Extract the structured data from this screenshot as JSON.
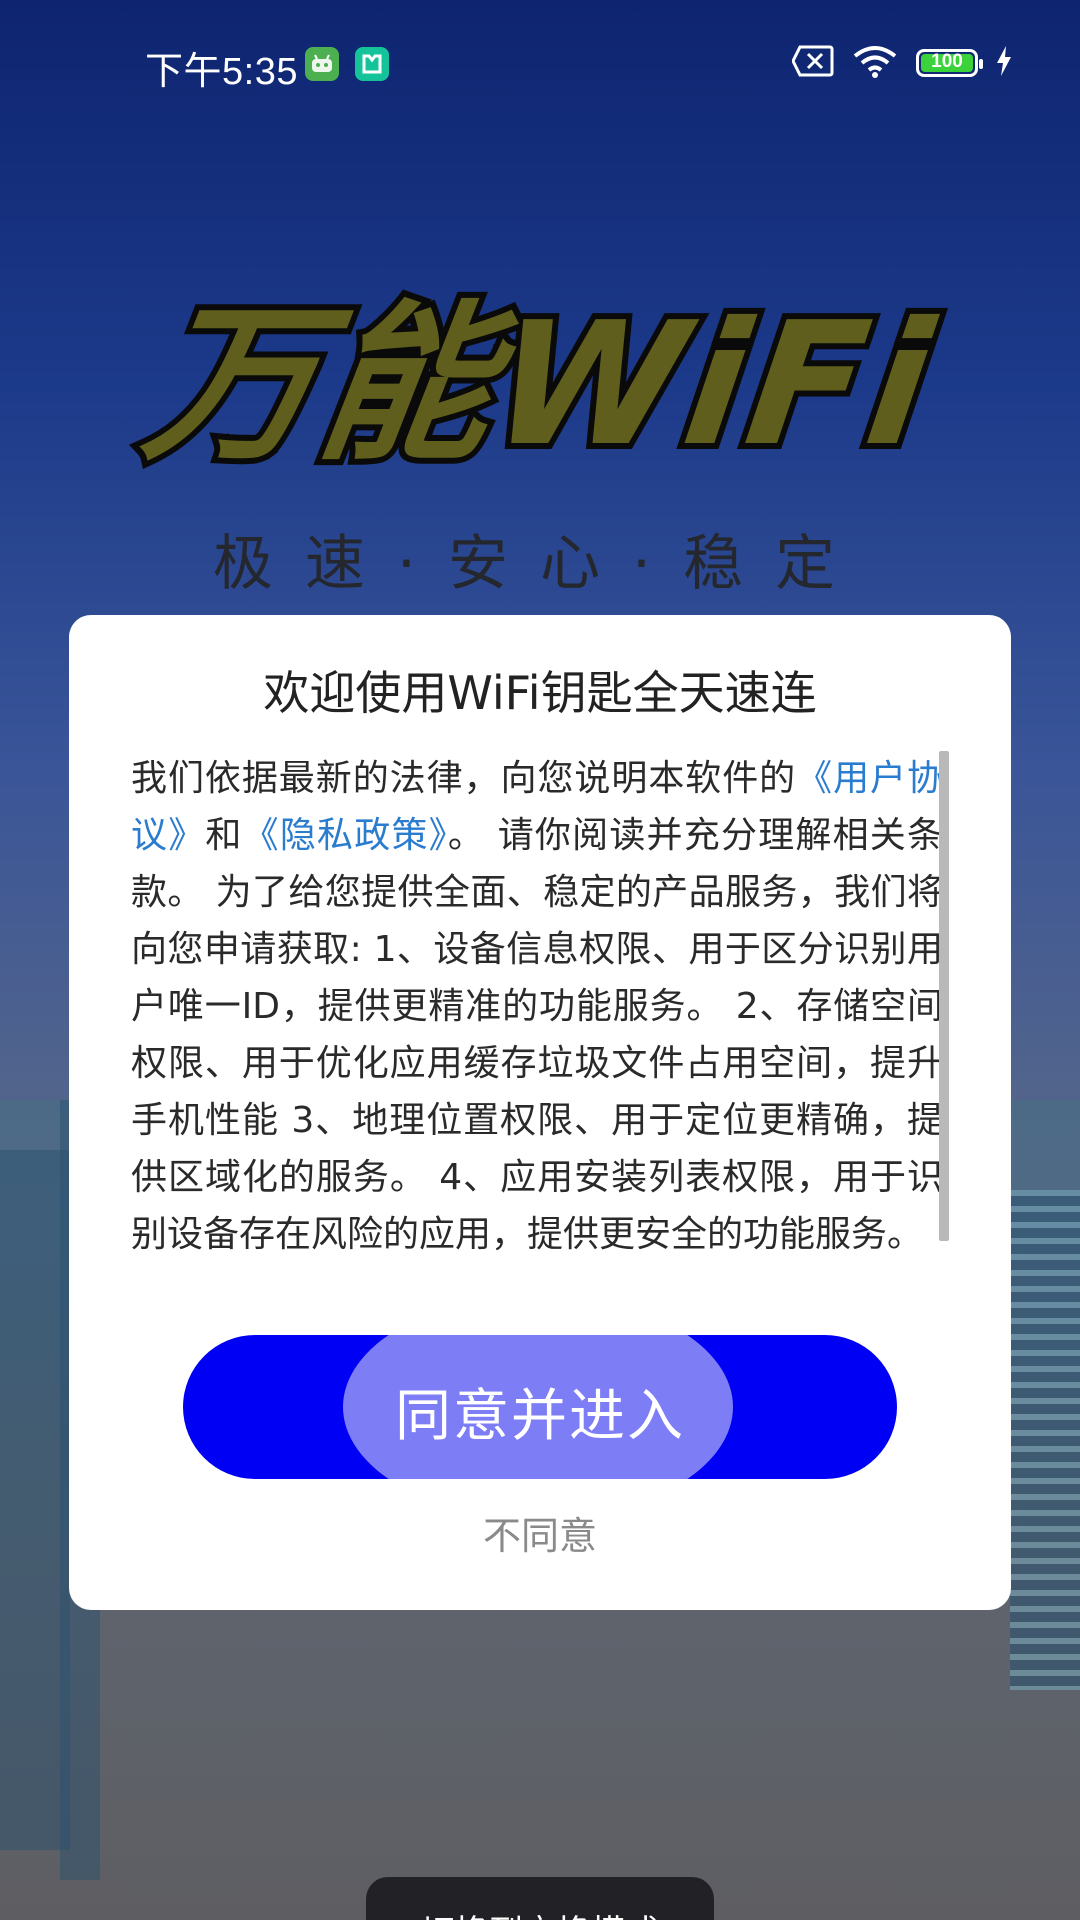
{
  "status_bar": {
    "time": "下午5:35",
    "battery_level": "100",
    "icons": [
      "android-robot-icon",
      "xiaomi-app-icon",
      "sim-blocked-icon",
      "wifi-icon",
      "battery-icon",
      "charging-bolt-icon"
    ]
  },
  "logo": {
    "title": "万能WiFi",
    "slogan": "极速·安心·稳定"
  },
  "dialog": {
    "title": "欢迎使用WiFi钥匙全天速连",
    "body": {
      "intro": "我们依据最新的法律，向您说明本软件的",
      "link_user_agreement": "《用户协议》",
      "and": "和",
      "link_privacy_policy": "《隐私政策》",
      "rest": "。 请你阅读并充分理解相关条款。 为了给您提供全面、稳定的产品服务，我们将向您申请获取: 1、设备信息权限、用于区分识别用户唯一ID，提供更精准的功能服务。 2、存储空间权限、用于优化应用缓存垃圾文件占用空间，提升手机性能 3、地理位置权限、用于定位更精确，提供区域化的服务。 4、应用安装列表权限，用于识别设备存在风险的应用，提供更安全的功能服务。"
    },
    "agree_button": "同意并进入",
    "disagree_button": "不同意"
  },
  "toast": {
    "text": "切换到交换模式"
  },
  "colors": {
    "agree_button": "#0000f5",
    "agree_highlight": "#7d7ef5",
    "link": "#2a7ccf",
    "logo_fill": "#5f5e1c"
  }
}
